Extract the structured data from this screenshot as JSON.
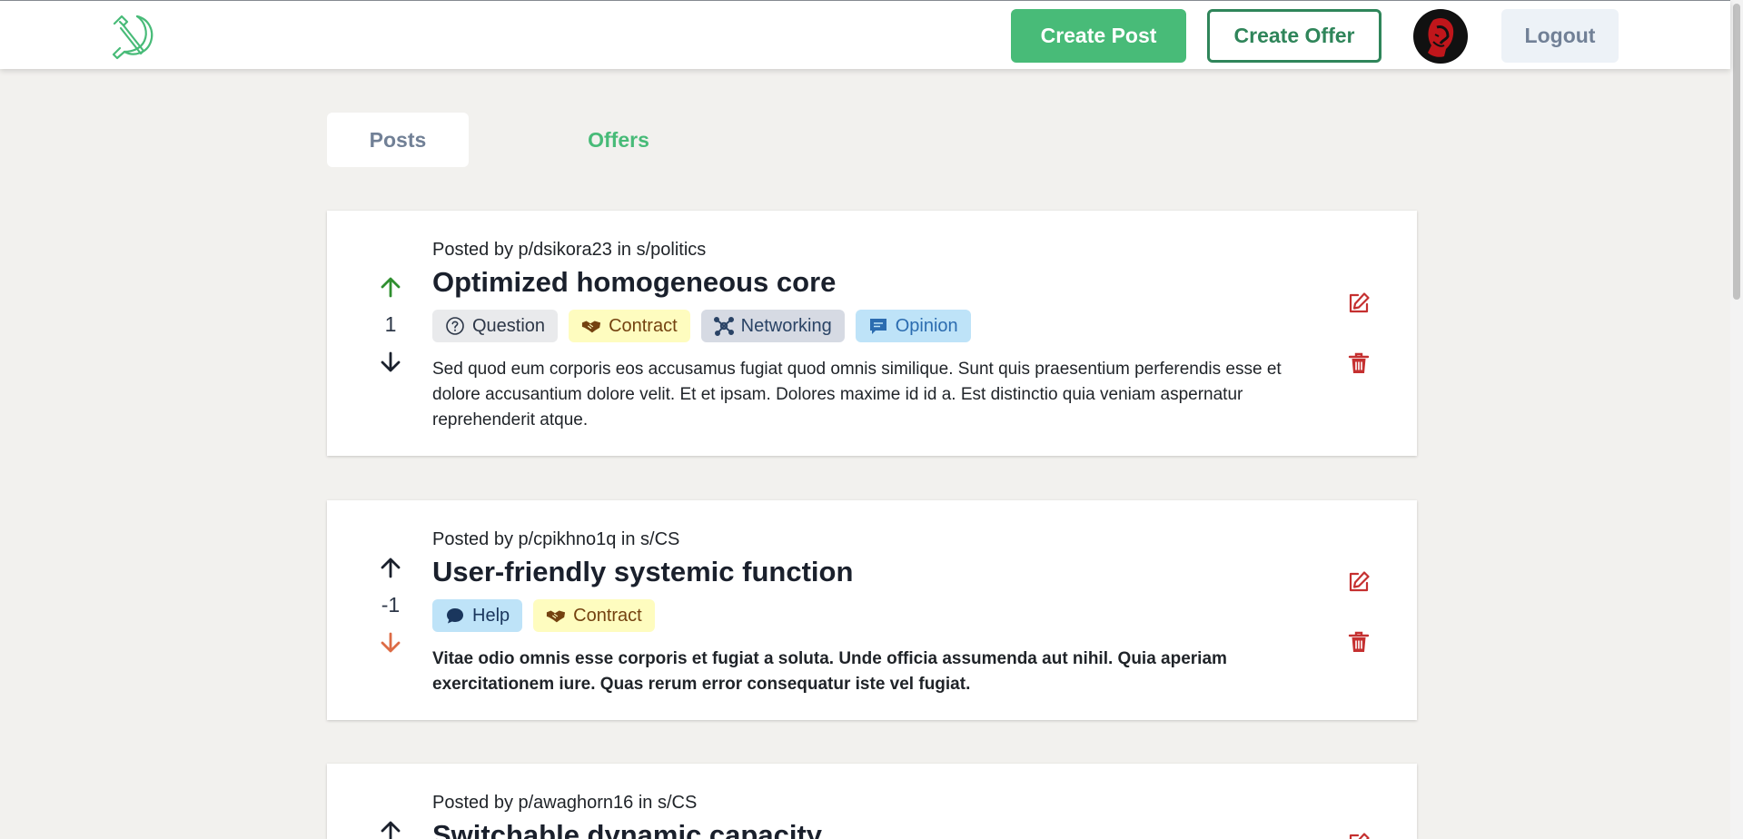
{
  "nav": {
    "create_post": "Create Post",
    "create_offer": "Create Offer",
    "logout": "Logout"
  },
  "tabs": {
    "posts": "Posts",
    "offers": "Offers"
  },
  "colors": {
    "green": "#48bb78",
    "dark_green": "#2f855a",
    "delete_red": "#c53030"
  },
  "posts": [
    {
      "meta": "Posted by p/dsikora23 in s/politics",
      "title": "Optimized homogeneous core",
      "score": "1",
      "vote_state": "up",
      "tags": [
        {
          "label": "Question",
          "icon": "question-icon"
        },
        {
          "label": "Contract",
          "icon": "handshake-icon"
        },
        {
          "label": "Networking",
          "icon": "network-icon"
        },
        {
          "label": "Opinion",
          "icon": "comment-icon"
        }
      ],
      "body": "Sed quod eum corporis eos accusamus fugiat quod omnis similique. Sunt quis praesentium perferendis esse et dolore accusantium dolore velit. Et et ipsam. Dolores maxime id id a. Est distinctio quia veniam aspernatur reprehenderit atque."
    },
    {
      "meta": "Posted by p/cpikhno1q in s/CS",
      "title": "User-friendly systemic function",
      "score": "-1",
      "vote_state": "down",
      "tags": [
        {
          "label": "Help",
          "icon": "chat-bubble-icon"
        },
        {
          "label": "Contract",
          "icon": "handshake-icon"
        }
      ],
      "body": "Vitae odio omnis esse corporis et fugiat a soluta. Unde officia assumenda aut nihil. Quia aperiam exercitationem iure. Quas rerum error consequatur iste vel fugiat."
    },
    {
      "meta": "Posted by p/awaghorn16 in s/CS",
      "title": "Switchable dynamic capacity",
      "vote_state": "none"
    }
  ]
}
